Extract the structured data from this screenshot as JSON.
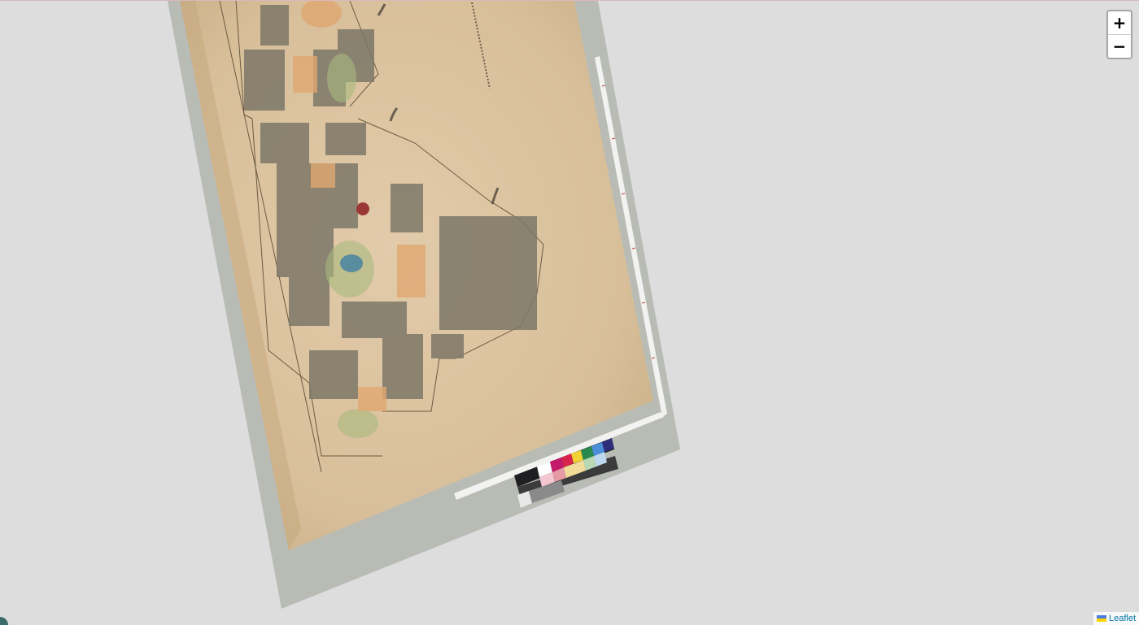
{
  "zoom": {
    "in_label": "+",
    "out_label": "−"
  },
  "attribution": {
    "label": "Leaflet"
  },
  "colors": {
    "background": "#dddddd",
    "mount": "#b9bcb6",
    "paper": "#dcc3a0",
    "accent_link": "#0078a8"
  },
  "icons": {
    "zoom_in": "plus-icon",
    "zoom_out": "minus-icon",
    "flag": "ukraine-flag-icon"
  }
}
